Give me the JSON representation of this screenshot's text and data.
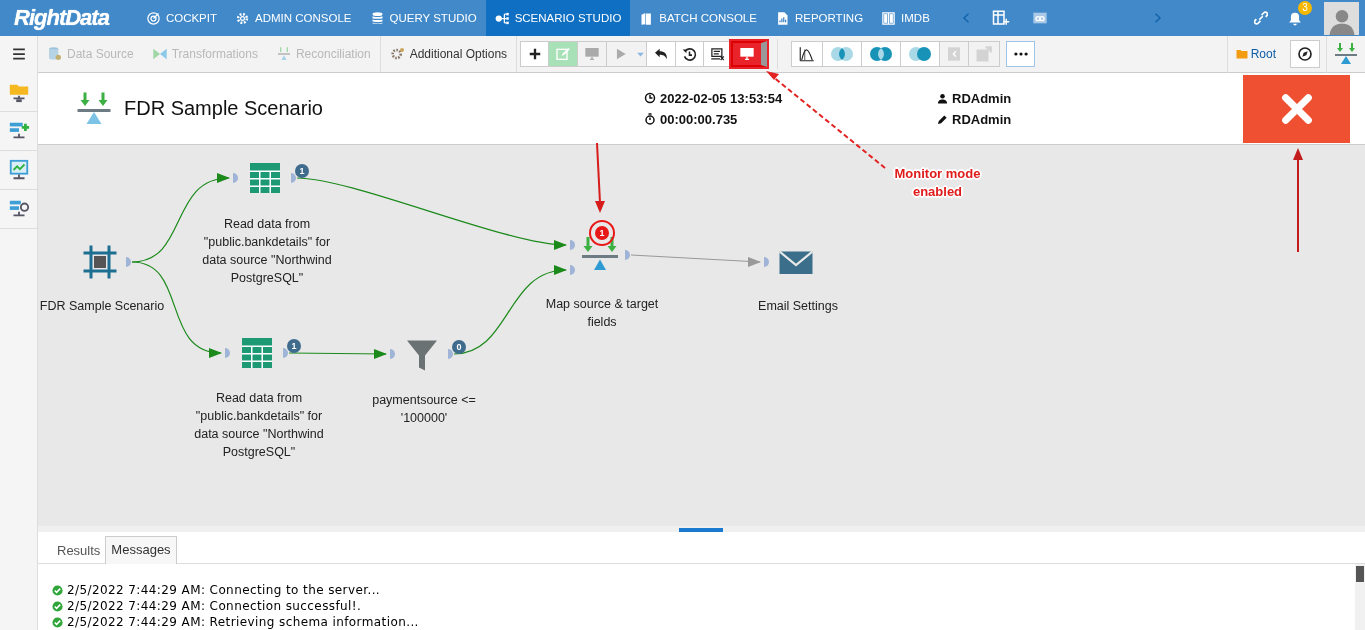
{
  "topnav": {
    "logo": "RightData",
    "items": [
      {
        "label": "COCKPIT",
        "selected": false
      },
      {
        "label": "ADMIN CONSOLE",
        "selected": false
      },
      {
        "label": "QUERY STUDIO",
        "selected": false
      },
      {
        "label": "SCENARIO STUDIO",
        "selected": true
      },
      {
        "label": "BATCH CONSOLE",
        "selected": false
      },
      {
        "label": "REPORTING",
        "selected": false
      },
      {
        "label": "IMDB",
        "selected": false
      }
    ],
    "notification_count": "3"
  },
  "toolbar": {
    "menu_items": [
      {
        "label": "Data Source",
        "disabled": true
      },
      {
        "label": "Transformations",
        "disabled": true
      },
      {
        "label": "Reconciliation",
        "disabled": true
      },
      {
        "label": "Additional Options",
        "disabled": false
      }
    ],
    "buttons": [
      {
        "kind": "plus",
        "disabled": false,
        "active": false
      },
      {
        "kind": "edit",
        "disabled": false,
        "active": true
      },
      {
        "kind": "monitor",
        "disabled": true,
        "active": false
      },
      {
        "kind": "play",
        "disabled": true,
        "active": false
      },
      {
        "kind": "caret",
        "disabled": true,
        "active": false
      },
      {
        "kind": "undo",
        "disabled": false,
        "active": false
      },
      {
        "kind": "history",
        "disabled": false,
        "active": false
      },
      {
        "kind": "report",
        "disabled": false,
        "active": false
      },
      {
        "kind": "monitor",
        "disabled": false,
        "active": true
      }
    ],
    "buttons_2": [
      {
        "kind": "curve",
        "disabled": false,
        "active": false
      },
      {
        "kind": "venn1",
        "disabled": false,
        "active": false
      },
      {
        "kind": "venn2",
        "disabled": false,
        "active": false
      },
      {
        "kind": "venn3",
        "disabled": false,
        "active": false
      },
      {
        "kind": "collapse",
        "disabled": true,
        "active": false
      },
      {
        "kind": "export",
        "disabled": true,
        "active": false
      },
      {
        "kind": "more",
        "disabled": false,
        "active": false
      }
    ],
    "root_label": "Root"
  },
  "header": {
    "title": "FDR Sample Scenario",
    "timestamp": "2022-02-05 13:53:54",
    "duration": "00:00:00.735",
    "created_by": "RDAdmin",
    "modified_by": "RDAdmin"
  },
  "canvas": {
    "nodes": [
      {
        "kind": "start",
        "label": "FDR Sample Scenario"
      },
      {
        "kind": "table",
        "label": "Read data from \"public.bankdetails\" for data source \"Northwind PostgreSQL\"",
        "count": "1",
        "highlighted": false
      },
      {
        "kind": "table",
        "label": "Read data from \"public.bankdetails\" for data source \"Northwind PostgreSQL\"",
        "count": "1",
        "highlighted": false
      },
      {
        "kind": "filter",
        "label": "paymentsource <= '100000'",
        "count": "0",
        "highlighted": false
      },
      {
        "kind": "map",
        "label": "Map source & target fields",
        "count": "1",
        "highlighted": true
      },
      {
        "kind": "email",
        "label": "Email Settings"
      }
    ]
  },
  "annotations": [
    {
      "text": "Monitor mode enabled"
    }
  ],
  "console": {
    "tabs": [
      {
        "label": "Results",
        "selected": false
      },
      {
        "label": "Messages",
        "selected": true
      }
    ],
    "messages": [
      {
        "text": "2/5/2022 7:44:29 AM: Connecting to the server..."
      },
      {
        "text": "2/5/2022 7:44:29 AM: Connection successful!."
      },
      {
        "text": "2/5/2022 7:44:29 AM: Retrieving schema information..."
      }
    ]
  }
}
